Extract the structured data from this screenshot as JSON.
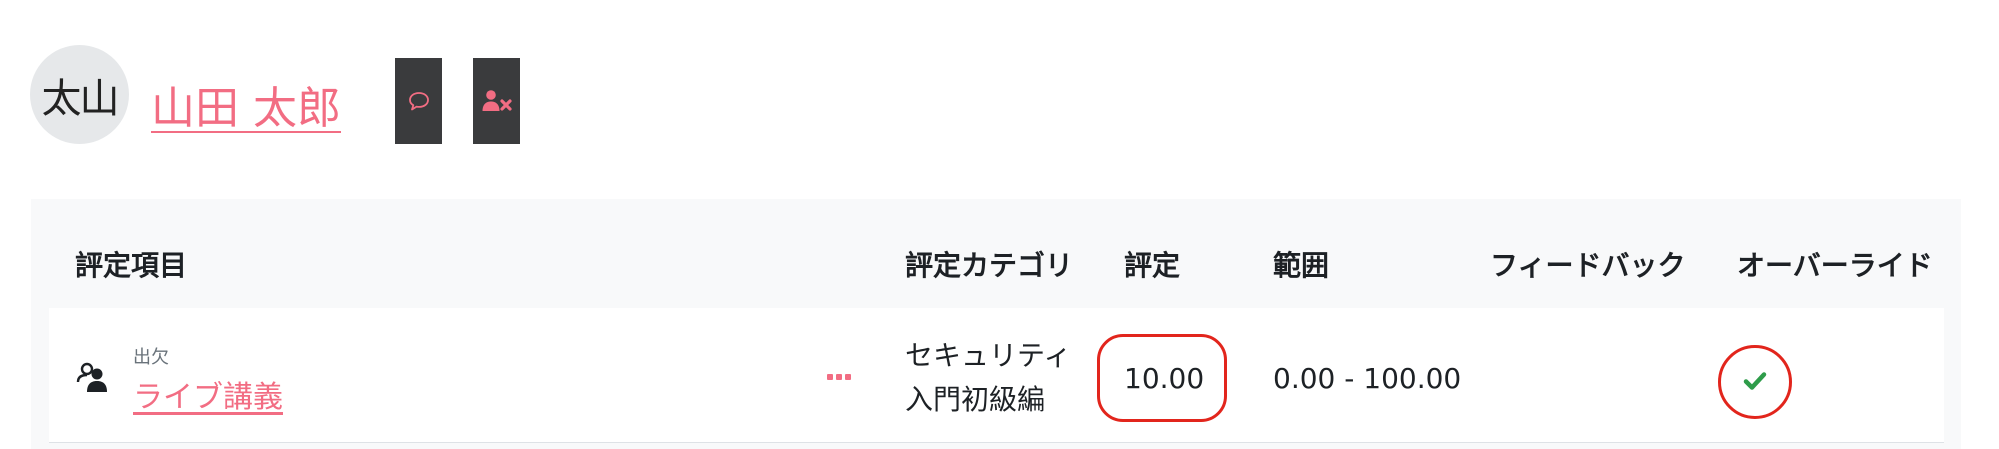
{
  "user": {
    "avatar_initials": "太山",
    "name": "山田 太郎"
  },
  "actions": {
    "message_icon": "speech-bubble-icon",
    "unenrol_icon": "user-remove-icon"
  },
  "colors": {
    "accent": "#f26d83",
    "button_bg": "#3a3b3d",
    "highlight_ring": "#e2251c",
    "check": "#2e9c4a",
    "panel_bg": "#f8f9fa"
  },
  "table": {
    "headers": {
      "item": "評定項目",
      "category": "評定カテゴリ",
      "grade": "評定",
      "range": "範囲",
      "feedback": "フィードバック",
      "override": "オーバーライド"
    },
    "rows": [
      {
        "item_type": "出欠",
        "item_name": "ライブ講義",
        "item_icon": "attendance-icon",
        "category_line1": "セキュリティ",
        "category_line2": "入門初級編",
        "grade": "10.00",
        "range": "0.00 - 100.00",
        "feedback": "",
        "override_icon": "check-icon"
      }
    ]
  }
}
